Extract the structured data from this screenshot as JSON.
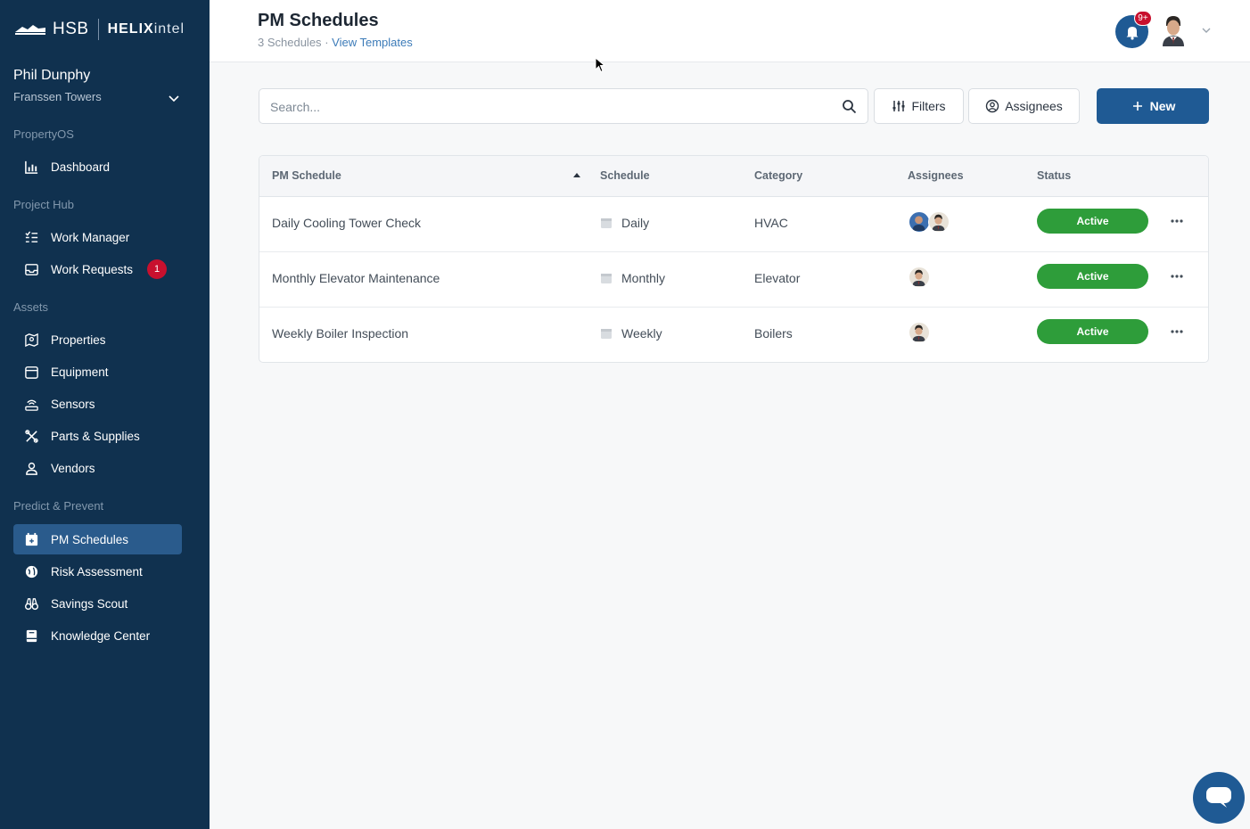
{
  "brand": {
    "hsb": "HSB",
    "helix_bold": "HELIX",
    "helix_light": "intel"
  },
  "user": {
    "name": "Phil Dunphy",
    "property": "Franssen Towers"
  },
  "sidebar": {
    "sections": [
      {
        "label": "PropertyOS"
      },
      {
        "label": "Project Hub"
      },
      {
        "label": "Assets"
      },
      {
        "label": "Predict & Prevent"
      }
    ],
    "items": [
      {
        "label": "Dashboard",
        "icon": "chart-icon"
      },
      {
        "label": "Work Manager",
        "icon": "list-check-icon"
      },
      {
        "label": "Work Requests",
        "icon": "inbox-icon",
        "badge": "1"
      },
      {
        "label": "Properties",
        "icon": "map-icon"
      },
      {
        "label": "Equipment",
        "icon": "equipment-icon"
      },
      {
        "label": "Sensors",
        "icon": "sensor-icon"
      },
      {
        "label": "Parts & Supplies",
        "icon": "tools-icon"
      },
      {
        "label": "Vendors",
        "icon": "vendor-icon"
      },
      {
        "label": "PM Schedules",
        "icon": "calendar-icon",
        "active": true
      },
      {
        "label": "Risk Assessment",
        "icon": "globe-icon"
      },
      {
        "label": "Savings Scout",
        "icon": "binoculars-icon"
      },
      {
        "label": "Knowledge Center",
        "icon": "book-icon"
      }
    ]
  },
  "header": {
    "title": "PM Schedules",
    "count": "3 Schedules",
    "separator": "·",
    "templates_link": "View Templates",
    "notif_badge": "9+"
  },
  "toolbar": {
    "search_placeholder": "Search...",
    "filters_label": "Filters",
    "assignees_label": "Assignees",
    "new_label": "New"
  },
  "table": {
    "columns": [
      "PM Schedule",
      "Schedule",
      "Category",
      "Assignees",
      "Status"
    ],
    "rows": [
      {
        "name": "Daily Cooling Tower Check",
        "schedule": "Daily",
        "category": "HVAC",
        "status": "Active"
      },
      {
        "name": "Monthly Elevator Maintenance",
        "schedule": "Monthly",
        "category": "Elevator",
        "status": "Active"
      },
      {
        "name": "Weekly Boiler Inspection",
        "schedule": "Weekly",
        "category": "Boilers",
        "status": "Active"
      }
    ]
  },
  "colors": {
    "sidebar_bg": "#10314f",
    "sidebar_active": "#2a5b8c",
    "primary": "#1f5a94",
    "status_active": "#2e9d3a",
    "badge_red": "#c8102e"
  }
}
